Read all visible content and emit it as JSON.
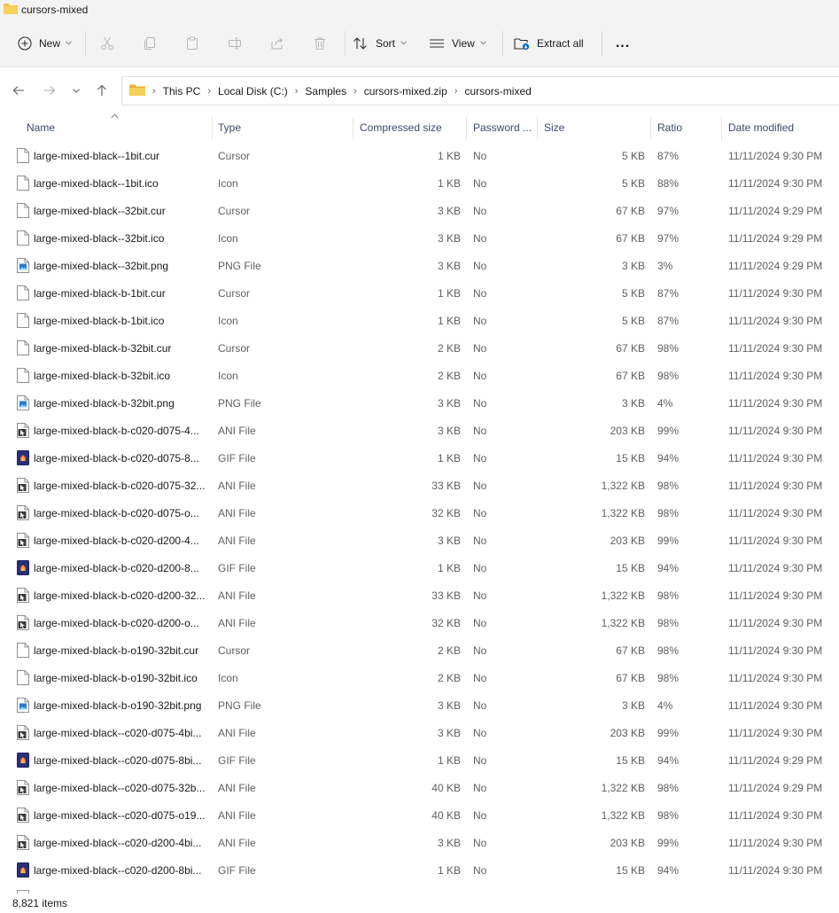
{
  "window": {
    "title": "cursors-mixed"
  },
  "toolbar": {
    "new_label": "New",
    "sort_label": "Sort",
    "view_label": "View",
    "extract_label": "Extract all",
    "more_label": "..."
  },
  "breadcrumb": [
    "This PC",
    "Local Disk (C:)",
    "Samples",
    "cursors-mixed.zip",
    "cursors-mixed"
  ],
  "columns": {
    "name": "Name",
    "type": "Type",
    "compressed_size": "Compressed size",
    "password": "Password ...",
    "size": "Size",
    "ratio": "Ratio",
    "date_modified": "Date modified"
  },
  "files": [
    {
      "icon": "cur",
      "name": "large-mixed-black--1bit.cur",
      "type": "Cursor",
      "csize": "1 KB",
      "pw": "No",
      "size": "5 KB",
      "ratio": "87%",
      "date": "11/11/2024 9:30 PM"
    },
    {
      "icon": "cur",
      "name": "large-mixed-black--1bit.ico",
      "type": "Icon",
      "csize": "1 KB",
      "pw": "No",
      "size": "5 KB",
      "ratio": "88%",
      "date": "11/11/2024 9:30 PM"
    },
    {
      "icon": "cur",
      "name": "large-mixed-black--32bit.cur",
      "type": "Cursor",
      "csize": "3 KB",
      "pw": "No",
      "size": "67 KB",
      "ratio": "97%",
      "date": "11/11/2024 9:29 PM"
    },
    {
      "icon": "cur",
      "name": "large-mixed-black--32bit.ico",
      "type": "Icon",
      "csize": "3 KB",
      "pw": "No",
      "size": "67 KB",
      "ratio": "97%",
      "date": "11/11/2024 9:29 PM"
    },
    {
      "icon": "png",
      "name": "large-mixed-black--32bit.png",
      "type": "PNG File",
      "csize": "3 KB",
      "pw": "No",
      "size": "3 KB",
      "ratio": "3%",
      "date": "11/11/2024 9:29 PM"
    },
    {
      "icon": "cur",
      "name": "large-mixed-black-b-1bit.cur",
      "type": "Cursor",
      "csize": "1 KB",
      "pw": "No",
      "size": "5 KB",
      "ratio": "87%",
      "date": "11/11/2024 9:30 PM"
    },
    {
      "icon": "cur",
      "name": "large-mixed-black-b-1bit.ico",
      "type": "Icon",
      "csize": "1 KB",
      "pw": "No",
      "size": "5 KB",
      "ratio": "87%",
      "date": "11/11/2024 9:30 PM"
    },
    {
      "icon": "cur",
      "name": "large-mixed-black-b-32bit.cur",
      "type": "Cursor",
      "csize": "2 KB",
      "pw": "No",
      "size": "67 KB",
      "ratio": "98%",
      "date": "11/11/2024 9:30 PM"
    },
    {
      "icon": "cur",
      "name": "large-mixed-black-b-32bit.ico",
      "type": "Icon",
      "csize": "2 KB",
      "pw": "No",
      "size": "67 KB",
      "ratio": "98%",
      "date": "11/11/2024 9:30 PM"
    },
    {
      "icon": "png",
      "name": "large-mixed-black-b-32bit.png",
      "type": "PNG File",
      "csize": "3 KB",
      "pw": "No",
      "size": "3 KB",
      "ratio": "4%",
      "date": "11/11/2024 9:30 PM"
    },
    {
      "icon": "ani",
      "name": "large-mixed-black-b-c020-d075-4...",
      "type": "ANI File",
      "csize": "3 KB",
      "pw": "No",
      "size": "203 KB",
      "ratio": "99%",
      "date": "11/11/2024 9:30 PM"
    },
    {
      "icon": "gif",
      "name": "large-mixed-black-b-c020-d075-8...",
      "type": "GIF File",
      "csize": "1 KB",
      "pw": "No",
      "size": "15 KB",
      "ratio": "94%",
      "date": "11/11/2024 9:30 PM"
    },
    {
      "icon": "ani",
      "name": "large-mixed-black-b-c020-d075-32...",
      "type": "ANI File",
      "csize": "33 KB",
      "pw": "No",
      "size": "1,322 KB",
      "ratio": "98%",
      "date": "11/11/2024 9:30 PM"
    },
    {
      "icon": "ani",
      "name": "large-mixed-black-b-c020-d075-o...",
      "type": "ANI File",
      "csize": "32 KB",
      "pw": "No",
      "size": "1,322 KB",
      "ratio": "98%",
      "date": "11/11/2024 9:30 PM"
    },
    {
      "icon": "ani",
      "name": "large-mixed-black-b-c020-d200-4...",
      "type": "ANI File",
      "csize": "3 KB",
      "pw": "No",
      "size": "203 KB",
      "ratio": "99%",
      "date": "11/11/2024 9:30 PM"
    },
    {
      "icon": "gif",
      "name": "large-mixed-black-b-c020-d200-8...",
      "type": "GIF File",
      "csize": "1 KB",
      "pw": "No",
      "size": "15 KB",
      "ratio": "94%",
      "date": "11/11/2024 9:30 PM"
    },
    {
      "icon": "ani",
      "name": "large-mixed-black-b-c020-d200-32...",
      "type": "ANI File",
      "csize": "33 KB",
      "pw": "No",
      "size": "1,322 KB",
      "ratio": "98%",
      "date": "11/11/2024 9:30 PM"
    },
    {
      "icon": "ani",
      "name": "large-mixed-black-b-c020-d200-o...",
      "type": "ANI File",
      "csize": "32 KB",
      "pw": "No",
      "size": "1,322 KB",
      "ratio": "98%",
      "date": "11/11/2024 9:30 PM"
    },
    {
      "icon": "cur",
      "name": "large-mixed-black-b-o190-32bit.cur",
      "type": "Cursor",
      "csize": "2 KB",
      "pw": "No",
      "size": "67 KB",
      "ratio": "98%",
      "date": "11/11/2024 9:30 PM"
    },
    {
      "icon": "cur",
      "name": "large-mixed-black-b-o190-32bit.ico",
      "type": "Icon",
      "csize": "2 KB",
      "pw": "No",
      "size": "67 KB",
      "ratio": "98%",
      "date": "11/11/2024 9:30 PM"
    },
    {
      "icon": "png",
      "name": "large-mixed-black-b-o190-32bit.png",
      "type": "PNG File",
      "csize": "3 KB",
      "pw": "No",
      "size": "3 KB",
      "ratio": "4%",
      "date": "11/11/2024 9:30 PM"
    },
    {
      "icon": "ani",
      "name": "large-mixed-black--c020-d075-4bi...",
      "type": "ANI File",
      "csize": "3 KB",
      "pw": "No",
      "size": "203 KB",
      "ratio": "99%",
      "date": "11/11/2024 9:30 PM"
    },
    {
      "icon": "gif",
      "name": "large-mixed-black--c020-d075-8bi...",
      "type": "GIF File",
      "csize": "1 KB",
      "pw": "No",
      "size": "15 KB",
      "ratio": "94%",
      "date": "11/11/2024 9:29 PM"
    },
    {
      "icon": "ani",
      "name": "large-mixed-black--c020-d075-32b...",
      "type": "ANI File",
      "csize": "40 KB",
      "pw": "No",
      "size": "1,322 KB",
      "ratio": "98%",
      "date": "11/11/2024 9:29 PM"
    },
    {
      "icon": "ani",
      "name": "large-mixed-black--c020-d075-o19...",
      "type": "ANI File",
      "csize": "40 KB",
      "pw": "No",
      "size": "1,322 KB",
      "ratio": "98%",
      "date": "11/11/2024 9:30 PM"
    },
    {
      "icon": "ani",
      "name": "large-mixed-black--c020-d200-4bi...",
      "type": "ANI File",
      "csize": "3 KB",
      "pw": "No",
      "size": "203 KB",
      "ratio": "99%",
      "date": "11/11/2024 9:30 PM"
    },
    {
      "icon": "gif",
      "name": "large-mixed-black--c020-d200-8bi...",
      "type": "GIF File",
      "csize": "1 KB",
      "pw": "No",
      "size": "15 KB",
      "ratio": "94%",
      "date": "11/11/2024 9:30 PM"
    }
  ],
  "status": {
    "item_count": "8,821 items"
  },
  "colors": {
    "accent": "#0067c0",
    "folder": "#f0c24b",
    "header_text": "#3b4a6b",
    "muted_text": "#5f5f5f"
  },
  "icons": {
    "cur": "blank-file-icon",
    "png": "image-file-icon",
    "ani": "animated-cursor-file-icon",
    "gif": "gif-file-icon"
  }
}
